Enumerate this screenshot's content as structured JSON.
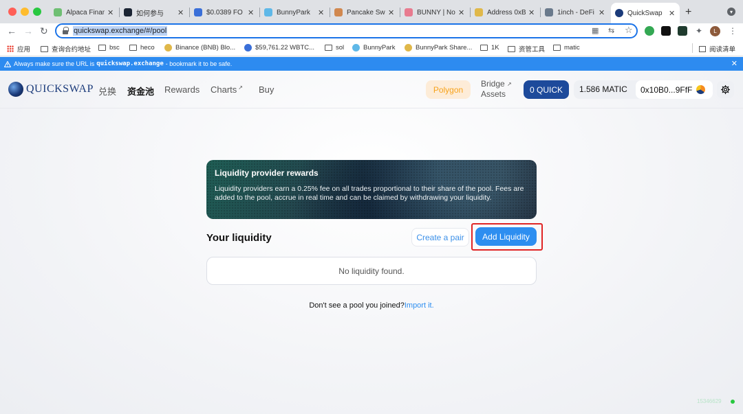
{
  "browser": {
    "tabs": [
      {
        "title": "Alpaca Finan",
        "favicon_color": "#6fbf73"
      },
      {
        "title": "如何参与",
        "favicon_color": "#1b2433"
      },
      {
        "title": "$0.0389 FO",
        "favicon_color": "#3a6fd8"
      },
      {
        "title": "BunnyPark",
        "favicon_color": "#5fb8e8"
      },
      {
        "title": "Pancake Sw",
        "favicon_color": "#d1884f"
      },
      {
        "title": "BUNNY | No",
        "favicon_color": "#e87b8f"
      },
      {
        "title": "Address 0xB",
        "favicon_color": "#e0b84a"
      },
      {
        "title": "1inch - DeFi",
        "favicon_color": "#6a7a8c"
      },
      {
        "title": "QuickSwap",
        "favicon_color": "#1b3b7a"
      }
    ],
    "url": "quickswap.exchange/#/pool",
    "avatar_letter": "L",
    "bookmarks": [
      {
        "label": "应用",
        "type": "apps"
      },
      {
        "label": "查询合约地址",
        "type": "folder"
      },
      {
        "label": "bsc",
        "type": "folder"
      },
      {
        "label": "heco",
        "type": "folder"
      },
      {
        "label": "Binance (BNB) Blo...",
        "type": "site"
      },
      {
        "label": "$59,761.22 WBTC...",
        "type": "site"
      },
      {
        "label": "sol",
        "type": "folder"
      },
      {
        "label": "BunnyPark",
        "type": "site"
      },
      {
        "label": "BunnyPark Share...",
        "type": "site"
      },
      {
        "label": "1K",
        "type": "folder"
      },
      {
        "label": "资管工具",
        "type": "folder"
      },
      {
        "label": "matic",
        "type": "folder"
      }
    ],
    "reading_list": "阅读清单"
  },
  "banner": {
    "prefix": "Always make sure the URL is",
    "domain": "quickswap.exchange",
    "suffix": "- bookmark it to be safe."
  },
  "header": {
    "logo_text": "QUICKSWAP",
    "nav": {
      "swap": "兑换",
      "pool": "资金池",
      "rewards": "Rewards",
      "charts": "Charts",
      "buy": "Buy"
    },
    "network": "Polygon",
    "bridge_line1": "Bridge",
    "bridge_line2": "Assets",
    "quick_balance": "0 QUICK",
    "matic_balance": "1.586 MATIC",
    "address": "0x10B0...9FfF"
  },
  "pool": {
    "rewards_title": "Liquidity provider rewards",
    "rewards_text": "Liquidity providers earn a 0.25% fee on all trades proportional to their share of the pool. Fees are added to the pool, accrue in real time and can be claimed by withdrawing your liquidity.",
    "your_liquidity": "Your liquidity",
    "create_pair": "Create a pair",
    "add_liquidity": "Add Liquidity",
    "empty_message": "No liquidity found.",
    "import_prompt": "Don't see a pool you joined?",
    "import_link": "Import it."
  },
  "footer": {
    "build_id": "15346629"
  }
}
